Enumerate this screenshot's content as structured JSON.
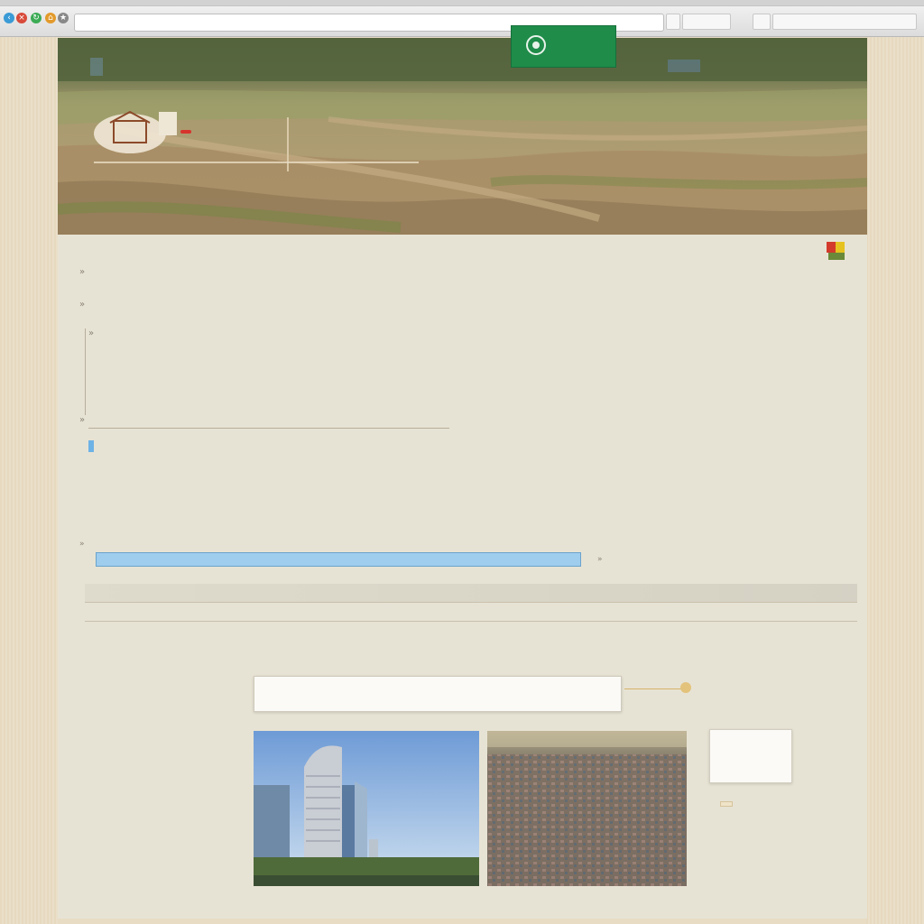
{
  "browser": {
    "tab_text": "",
    "address_url": "",
    "toolbar_items": [
      "",
      "",
      "",
      ""
    ],
    "nav_colors": [
      "#3a9bd6",
      "#d84a3a",
      "#3cab55",
      "#e39a2b"
    ]
  },
  "hero": {
    "cta_label": "",
    "badge_text": "",
    "caption": ""
  },
  "content": {
    "lines": [
      "",
      "",
      "",
      "",
      "",
      ""
    ],
    "link_highlight": "",
    "link_rest": "",
    "section_label": ""
  },
  "search": {
    "value": "",
    "side_text": ""
  },
  "table": {
    "header": [
      "",
      "",
      "",
      ""
    ],
    "row1": [
      "",
      "",
      "",
      "",
      "",
      ""
    ],
    "row2": [
      "",
      "",
      "",
      ""
    ],
    "row3": [
      ""
    ]
  },
  "midbox": {
    "left": "",
    "right": "",
    "link": ""
  },
  "gallery": {
    "side_label": "",
    "caption1": "",
    "caption2": "",
    "card_title": "",
    "card_sub": "",
    "button": "",
    "link": ""
  },
  "colors": {
    "accent_green": "#1f8c4a",
    "badge_red": "#d7332d",
    "highlight_blue": "#6eb3e6",
    "page_bg": "#e7e3d4"
  }
}
